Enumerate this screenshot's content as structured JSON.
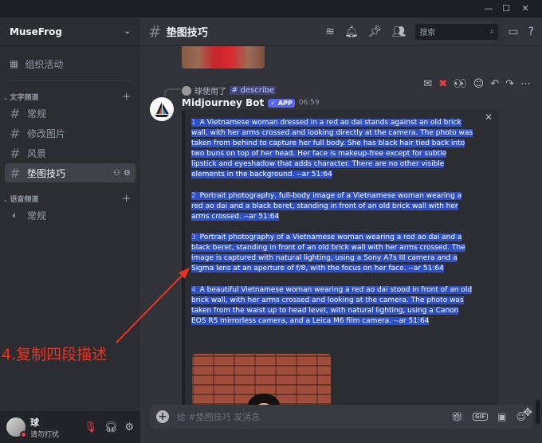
{
  "server": {
    "name": "MuseFrog"
  },
  "sidebar": {
    "events_label": "组织活动",
    "text_category": "文字频道",
    "voice_category": "语音频道",
    "text_channels": [
      {
        "label": "常规"
      },
      {
        "label": "修改图片"
      },
      {
        "label": "风景"
      },
      {
        "label": "垫图技巧"
      }
    ],
    "voice_channels": [
      {
        "label": "常规"
      }
    ]
  },
  "user": {
    "name": "球",
    "status": "请勿打扰"
  },
  "channel": {
    "title": "垫图技巧",
    "search_placeholder": "搜索"
  },
  "reply": {
    "user": "球使用了",
    "command": "# describe"
  },
  "message": {
    "author": "Midjourney Bot",
    "badge": "✓ APP",
    "time": "06:59",
    "paragraphs": [
      {
        "num": "1",
        "text": "A Vietnamese woman dressed in a red ao dai stands against an old brick wall, with her arms crossed and looking directly at the camera. The photo was taken from behind to capture her full body. She has black hair tied back into two buns on top of her head. Her face is makeup-free except for subtle lipstick and eyeshadow that adds character. There are no other visible elements in the background. --ar 51:64"
      },
      {
        "num": "2",
        "text": "Portrait photography, full-body image of a Vietnamese woman wearing a red ao dai and a black beret, standing in front of an old brick wall with her arms crossed. --ar 51:64"
      },
      {
        "num": "3",
        "text": "Portrait photography of a Vietnamese woman wearing a red ao dai and a black beret, standing in front of an old brick wall with her arms crossed. The image is captured with natural lighting, using a Sony A7s III camera and a Sigma lens at an aperture of f/8, with the focus on her face. --ar 51:64"
      },
      {
        "num": "4",
        "text": "A beautiful Vietnamese woman wearing a red ao dai stood in front of an old brick wall, with her arms crossed and looking at the camera. The photo was taken from the waist up to head level, with natural lighting, using a Canon EOS R5 mirrorless camera, and a Leica M6 film camera. --ar 51:64"
      }
    ]
  },
  "input": {
    "placeholder": "给 #垫图技巧 发消息"
  },
  "annotation": {
    "text": "4.复制四段描述",
    "color": "#ea3323"
  },
  "colors": {
    "highlight": "#2f4fc4",
    "accent": "#5865f2"
  }
}
